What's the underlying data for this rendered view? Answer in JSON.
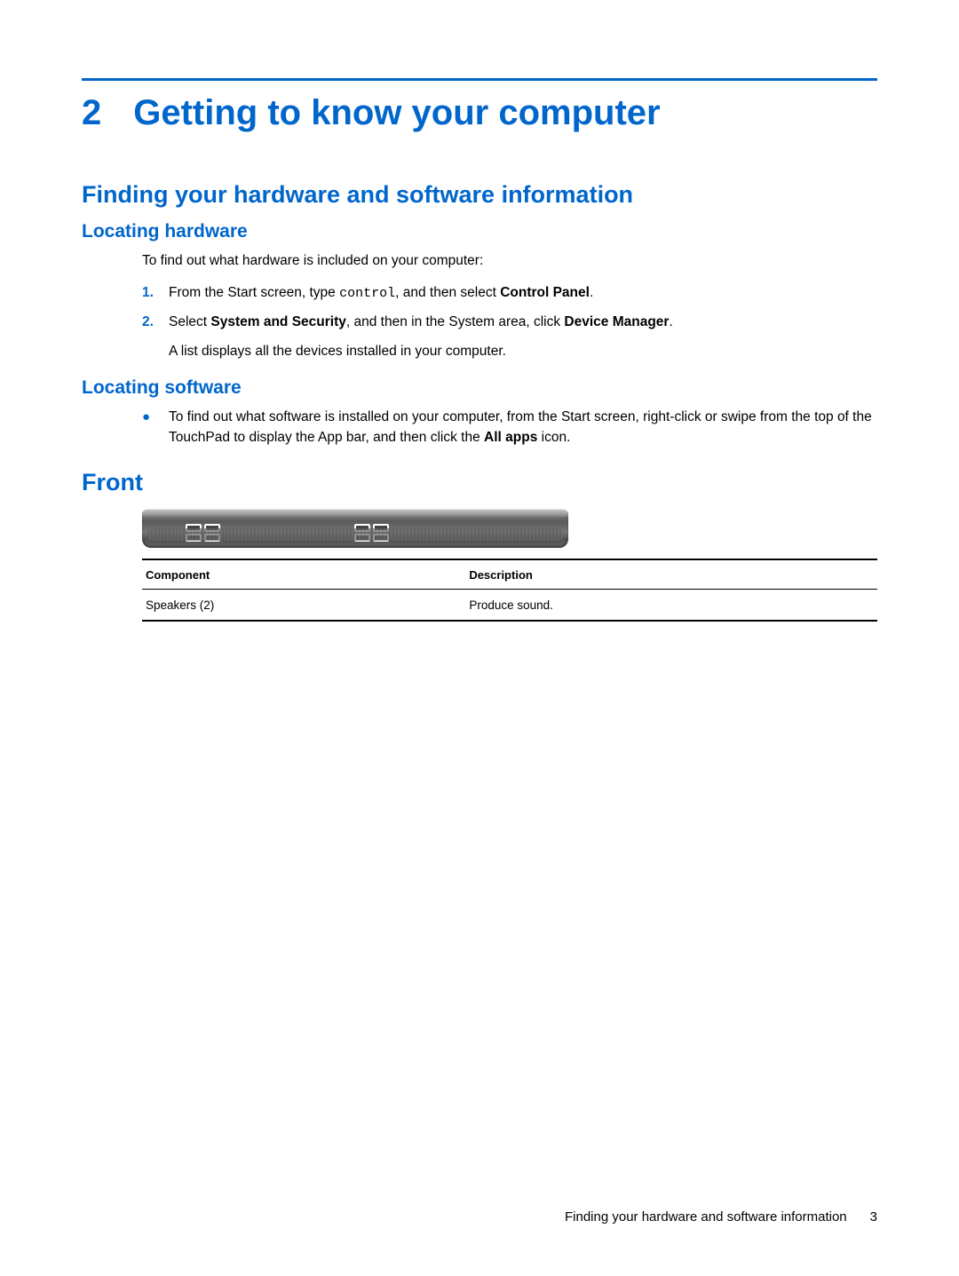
{
  "chapter": {
    "number": "2",
    "title": "Getting to know your computer"
  },
  "section1": {
    "heading": "Finding your hardware and software information",
    "sub1": {
      "heading": "Locating hardware",
      "intro": "To find out what hardware is included on your computer:",
      "steps": [
        {
          "num": "1.",
          "pre": "From the Start screen, type ",
          "code": "control",
          "mid": ", and then select ",
          "bold1": "Control Panel",
          "post": "."
        },
        {
          "num": "2.",
          "pre": "Select ",
          "bold1": "System and Security",
          "mid": ", and then in the System area, click ",
          "bold2": "Device Manager",
          "post": ".",
          "sub": "A list displays all the devices installed in your computer."
        }
      ]
    },
    "sub2": {
      "heading": "Locating software",
      "bullet": {
        "pre": "To find out what software is installed on your computer, from the Start screen, right-click or swipe from the top of the TouchPad to display the App bar, and then click the ",
        "bold1": "All apps",
        "post": " icon."
      }
    }
  },
  "section2": {
    "heading": "Front",
    "table": {
      "head": {
        "c1": "Component",
        "c2": "Description"
      },
      "row1": {
        "c1": "Speakers (2)",
        "c2": "Produce sound."
      }
    }
  },
  "footer": {
    "text": "Finding your hardware and software information",
    "page": "3"
  }
}
